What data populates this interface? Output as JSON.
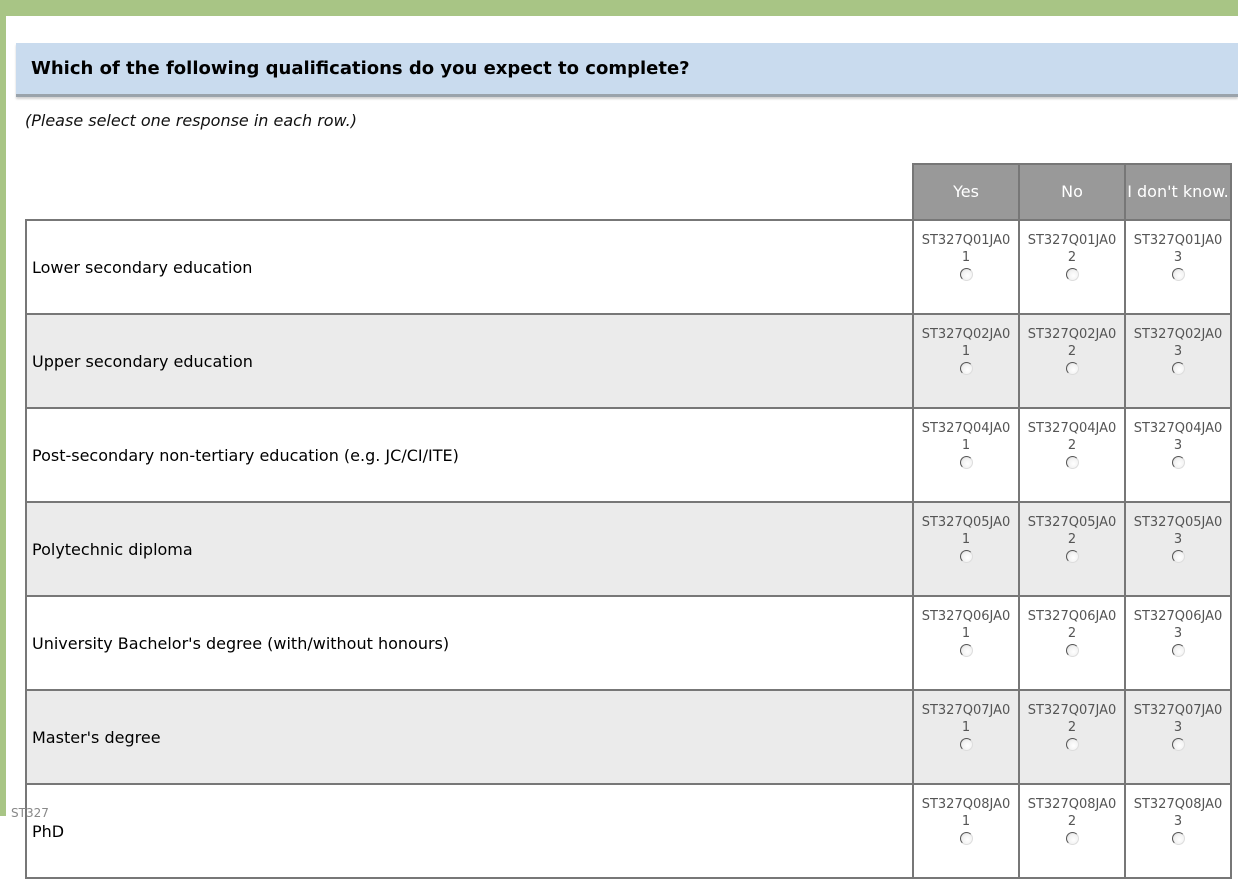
{
  "question": {
    "title": "Which of the following qualifications do you expect to complete?",
    "instruction": "(Please select one response in each row.)"
  },
  "columns": [
    {
      "label": "Yes"
    },
    {
      "label": "No"
    },
    {
      "label": "I don't know."
    }
  ],
  "rows": [
    {
      "label": "Lower secondary education",
      "options": [
        {
          "code": "ST327Q01JA0",
          "num": "1"
        },
        {
          "code": "ST327Q01JA0",
          "num": "2"
        },
        {
          "code": "ST327Q01JA0",
          "num": "3"
        }
      ]
    },
    {
      "label": "Upper secondary education",
      "options": [
        {
          "code": "ST327Q02JA0",
          "num": "1"
        },
        {
          "code": "ST327Q02JA0",
          "num": "2"
        },
        {
          "code": "ST327Q02JA0",
          "num": "3"
        }
      ]
    },
    {
      "label": "Post-secondary non-tertiary education (e.g. JC/CI/ITE)",
      "options": [
        {
          "code": "ST327Q04JA0",
          "num": "1"
        },
        {
          "code": "ST327Q04JA0",
          "num": "2"
        },
        {
          "code": "ST327Q04JA0",
          "num": "3"
        }
      ]
    },
    {
      "label": "Polytechnic diploma",
      "options": [
        {
          "code": "ST327Q05JA0",
          "num": "1"
        },
        {
          "code": "ST327Q05JA0",
          "num": "2"
        },
        {
          "code": "ST327Q05JA0",
          "num": "3"
        }
      ]
    },
    {
      "label": "University Bachelor's degree (with/without honours)",
      "options": [
        {
          "code": "ST327Q06JA0",
          "num": "1"
        },
        {
          "code": "ST327Q06JA0",
          "num": "2"
        },
        {
          "code": "ST327Q06JA0",
          "num": "3"
        }
      ]
    },
    {
      "label": "Master's degree",
      "options": [
        {
          "code": "ST327Q07JA0",
          "num": "1"
        },
        {
          "code": "ST327Q07JA0",
          "num": "2"
        },
        {
          "code": "ST327Q07JA0",
          "num": "3"
        }
      ]
    },
    {
      "label": "PhD",
      "options": [
        {
          "code": "ST327Q08JA0",
          "num": "1"
        },
        {
          "code": "ST327Q08JA0",
          "num": "2"
        },
        {
          "code": "ST327Q08JA0",
          "num": "3"
        }
      ]
    }
  ],
  "footer": {
    "code": "ST327"
  },
  "colors": {
    "frame": "#a8c585",
    "question_bg": "#c9dbee",
    "header_bg": "#999999",
    "alt_row": "#ebebeb"
  }
}
